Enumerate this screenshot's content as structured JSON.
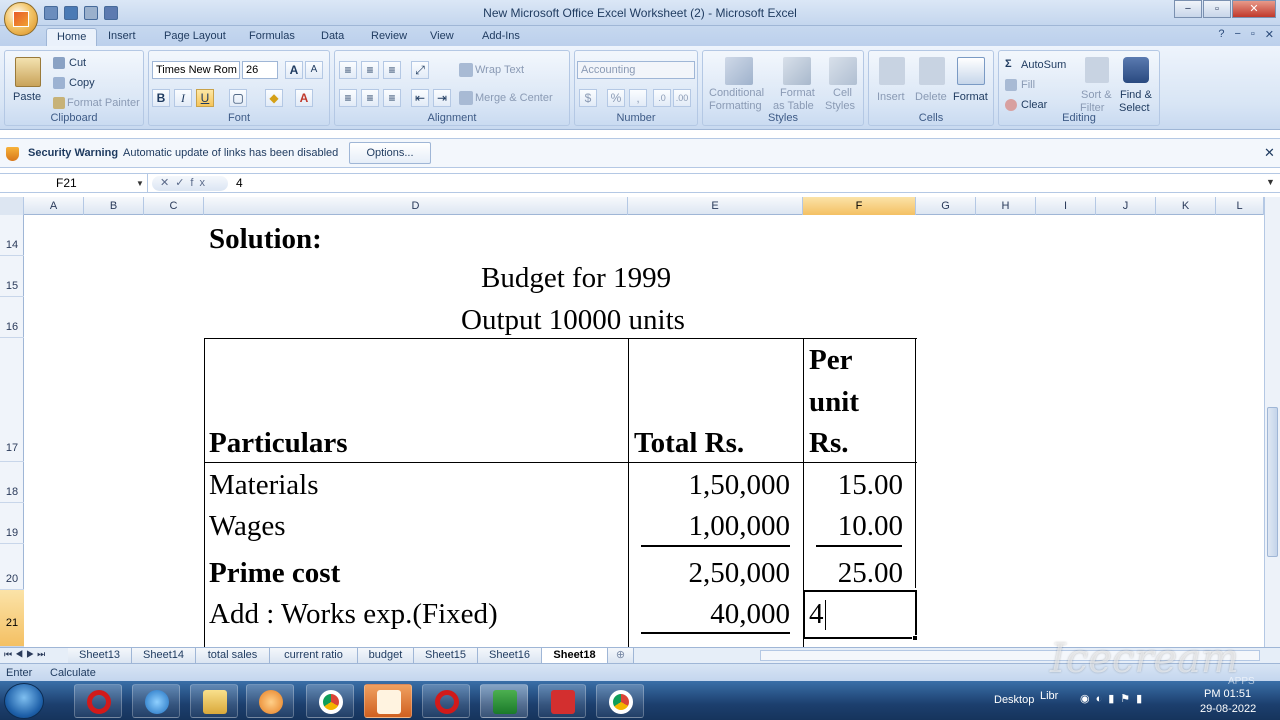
{
  "window": {
    "title": "New Microsoft Office Excel Worksheet (2) - Microsoft Excel",
    "minimize": "−",
    "restore": "▫",
    "close": "✕"
  },
  "tabs": [
    "Home",
    "Insert",
    "Page Layout",
    "Formulas",
    "Data",
    "Review",
    "View",
    "Add-Ins"
  ],
  "help": {
    "help_icon": "?",
    "min": "−",
    "restore": "▫",
    "close": "✕"
  },
  "ribbon": {
    "clipboard": {
      "label": "Clipboard",
      "paste": "Paste",
      "cut": "Cut",
      "copy": "Copy",
      "format_painter": "Format Painter"
    },
    "font": {
      "label": "Font",
      "name": "Times New Rom",
      "size": "26",
      "bold": "B",
      "italic": "I",
      "underline": "U",
      "grow": "A",
      "shrink": "A"
    },
    "alignment": {
      "label": "Alignment",
      "wrap_text": "Wrap Text",
      "merge_center": "Merge & Center"
    },
    "number": {
      "label": "Number",
      "format": "Accounting",
      "percent": "%"
    },
    "styles": {
      "label": "Styles",
      "conditional": "Conditional",
      "formatting": "Formatting",
      "format": "Format",
      "as_table": "as Table",
      "cell": "Cell",
      "styles": "Styles"
    },
    "cells": {
      "label": "Cells",
      "insert": "Insert",
      "delete": "Delete",
      "format": "Format"
    },
    "editing": {
      "label": "Editing",
      "autosum": "AutoSum",
      "fill": "Fill",
      "clear": "Clear",
      "sort": "Sort &",
      "filter": "Filter",
      "find": "Find &",
      "select": "Select"
    }
  },
  "security": {
    "title": "Security Warning",
    "message": "Automatic update of links has been disabled",
    "options": "Options..."
  },
  "formula_bar": {
    "name_box": "F21",
    "fx": "✕✓fx",
    "value": "4"
  },
  "columns": [
    "A",
    "B",
    "C",
    "D",
    "E",
    "F",
    "G",
    "H",
    "I",
    "J",
    "K",
    "L"
  ],
  "selected_column": "F",
  "rows": [
    "14",
    "15",
    "16",
    "17",
    "18",
    "19",
    "20",
    "21"
  ],
  "sheet": {
    "solution": "Solution:",
    "budget_title": "Budget for 1999",
    "output": "Output 10000 units",
    "header_particulars": "Particulars",
    "header_total": "Total Rs.",
    "header_per": "Per",
    "header_unit": "unit",
    "header_rs": "Rs.",
    "materials": "Materials",
    "materials_total": "1,50,000",
    "materials_unit": "15.00",
    "wages": "Wages",
    "wages_total": "1,00,000",
    "wages_unit": "10.00",
    "prime_cost": "Prime cost",
    "prime_total": "2,50,000",
    "prime_unit": "25.00",
    "works_exp": "Add : Works exp.(Fixed)",
    "works_total": "40,000",
    "works_unit_entry": "4"
  },
  "sheet_tabs": [
    "Sheet13",
    "Sheet14",
    "total sales",
    "current ratio",
    "budget",
    "Sheet15",
    "Sheet16",
    "Sheet18"
  ],
  "active_sheet": "Sheet18",
  "status": {
    "mode": "Enter",
    "calc": "Calculate"
  },
  "taskbar": {
    "desktop": "Desktop",
    "lib": "Libr",
    "time": "PM 01:51",
    "date": "29-08-2022"
  },
  "watermark": {
    "text": "Icecream",
    "sub": "APPS"
  }
}
